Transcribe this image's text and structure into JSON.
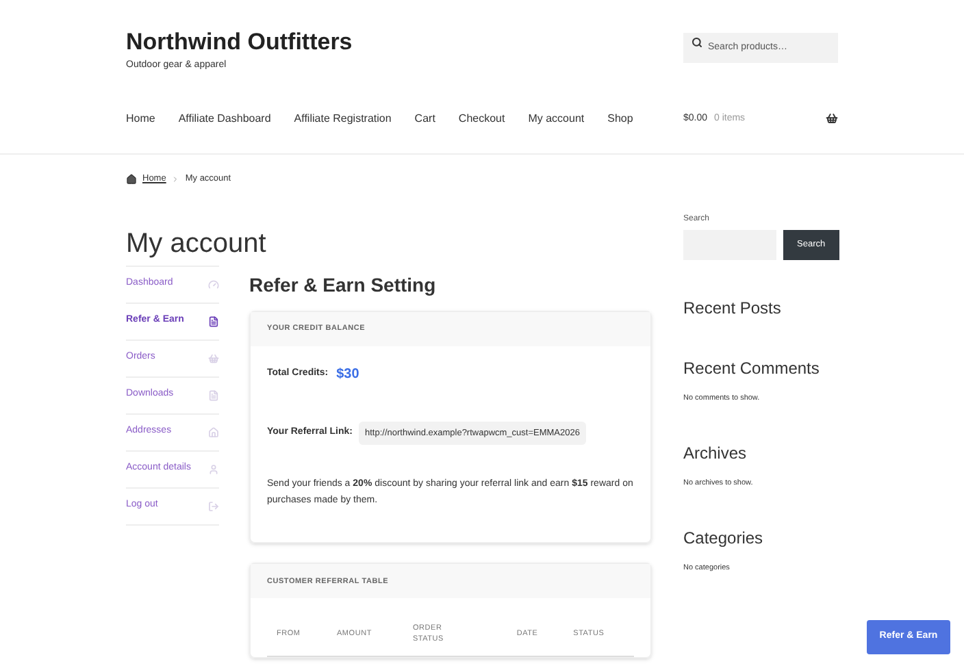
{
  "site": {
    "title": "Northwind Outfitters",
    "tagline": "Outdoor gear & apparel",
    "search_placeholder": "Search products…"
  },
  "nav": [
    {
      "label": "Home"
    },
    {
      "label": "Affiliate Dashboard"
    },
    {
      "label": "Affiliate Registration"
    },
    {
      "label": "Cart"
    },
    {
      "label": "Checkout"
    },
    {
      "label": "My account"
    },
    {
      "label": "Shop"
    }
  ],
  "cart": {
    "total": "$0.00",
    "items": "0 items"
  },
  "breadcrumb": {
    "home": "Home",
    "current": "My account"
  },
  "page_title": "My account",
  "account_menu": [
    {
      "label": "Dashboard",
      "selected": false
    },
    {
      "label": "Refer & Earn",
      "selected": true
    },
    {
      "label": "Orders",
      "selected": false
    },
    {
      "label": "Downloads",
      "selected": false
    },
    {
      "label": "Addresses",
      "selected": false
    },
    {
      "label": "Account details",
      "selected": false
    },
    {
      "label": "Log out",
      "selected": false
    }
  ],
  "section_title": "Refer & Earn Setting",
  "credit_card": {
    "header": "YOUR CREDIT BALANCE",
    "credits_label": "Total Credits:",
    "credits_value": "$30",
    "link_label": "Your Referral Link:",
    "link_value": "http://northwind.example?rtwapwcm_cust=EMMA2026",
    "description": "Send your friends a **20%**  discount by sharing your referral link and earn **$15** reward on purchases made by them."
  },
  "referral_table": {
    "header": "CUSTOMER REFERRAL TABLE",
    "columns": [
      "FROM",
      "AMOUNT",
      "ORDER STATUS",
      "DATE",
      "STATUS"
    ]
  },
  "widgets": {
    "search_label": "Search",
    "search_button": "Search",
    "recent_posts": "Recent Posts",
    "recent_comments": "Recent Comments",
    "no_comments": "No comments to show.",
    "archives": "Archives",
    "no_archives": "No archives to show.",
    "categories": "Categories",
    "no_categories": "No categories"
  },
  "floating_button": "Refer & Earn"
}
